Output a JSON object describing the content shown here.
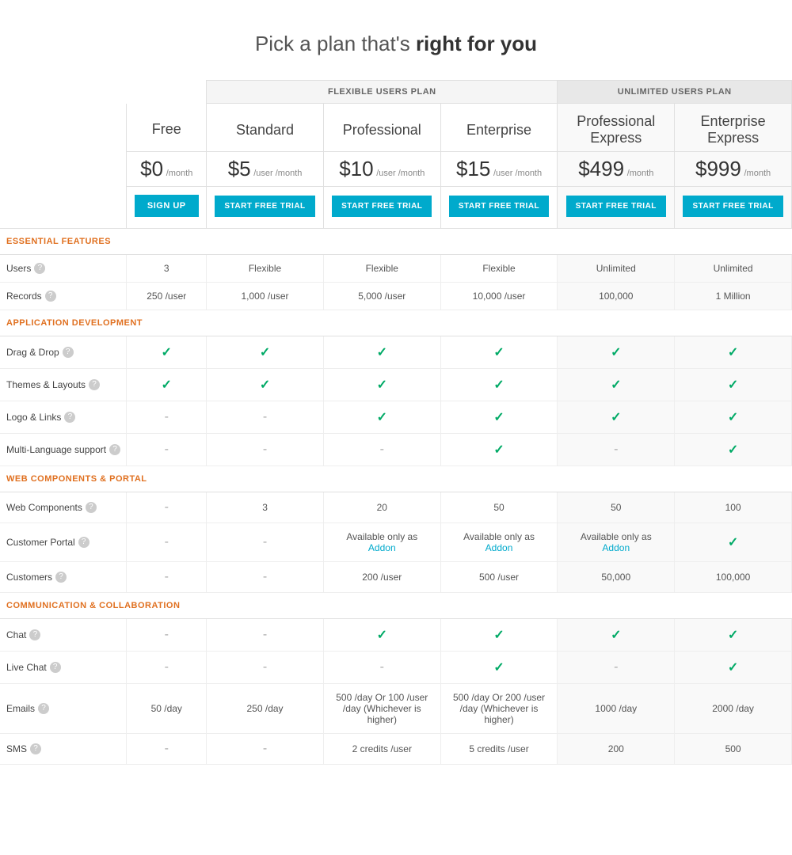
{
  "page": {
    "title_prefix": "Pick a plan that's ",
    "title_bold": "right for you"
  },
  "plans": {
    "flexible_label": "FLEXIBLE USERS PLAN",
    "unlimited_label": "UNLIMITED USERS PLAN",
    "columns": [
      {
        "id": "free",
        "name": "Free",
        "price": "$0",
        "price_sub": "/month",
        "cta": "SIGN UP",
        "cta_type": "signup"
      },
      {
        "id": "standard",
        "name": "Standard",
        "price": "$5",
        "price_sub": "/user /month",
        "cta": "START FREE TRIAL",
        "cta_type": "trial"
      },
      {
        "id": "professional",
        "name": "Professional",
        "price": "$10",
        "price_sub": "/user /month",
        "cta": "START FREE TRIAL",
        "cta_type": "trial"
      },
      {
        "id": "enterprise",
        "name": "Enterprise",
        "price": "$15",
        "price_sub": "/user /month",
        "cta": "START FREE TRIAL",
        "cta_type": "trial"
      },
      {
        "id": "pro_express",
        "name_line1": "Professional",
        "name_line2": "Express",
        "price": "$499",
        "price_sub": "/month",
        "cta": "START FREE TRIAL",
        "cta_type": "trial",
        "unlimited": true
      },
      {
        "id": "ent_express",
        "name_line1": "Enterprise",
        "name_line2": "Express",
        "price": "$999",
        "price_sub": "/month",
        "cta": "START FREE TRIAL",
        "cta_type": "trial",
        "unlimited": true
      }
    ]
  },
  "sections": [
    {
      "name": "ESSENTIAL FEATURES",
      "rows": [
        {
          "label": "Users",
          "help": true,
          "values": [
            "3",
            "Flexible",
            "Flexible",
            "Flexible",
            "Unlimited",
            "Unlimited"
          ]
        },
        {
          "label": "Records",
          "help": true,
          "values": [
            "250 /user",
            "1,000 /user",
            "5,000 /user",
            "10,000 /user",
            "100,000",
            "1 Million"
          ]
        }
      ]
    },
    {
      "name": "APPLICATION DEVELOPMENT",
      "rows": [
        {
          "label": "Drag & Drop",
          "help": true,
          "values": [
            "check",
            "check",
            "check",
            "check",
            "check",
            "check"
          ]
        },
        {
          "label": "Themes & Layouts",
          "help": true,
          "values": [
            "check",
            "check",
            "check",
            "check",
            "check",
            "check"
          ]
        },
        {
          "label": "Logo & Links",
          "help": true,
          "values": [
            "-",
            "-",
            "check",
            "check",
            "check",
            "check"
          ]
        },
        {
          "label": "Multi-Language support",
          "help": true,
          "values": [
            "-",
            "-",
            "-",
            "check",
            "-",
            "check"
          ]
        }
      ]
    },
    {
      "name": "WEB COMPONENTS & PORTAL",
      "rows": [
        {
          "label": "Web Components",
          "help": true,
          "values": [
            "-",
            "3",
            "20",
            "50",
            "50",
            "100"
          ]
        },
        {
          "label": "Customer Portal",
          "help": true,
          "values": [
            "-",
            "-",
            "addon",
            "addon",
            "addon",
            "check"
          ]
        },
        {
          "label": "Customers",
          "help": true,
          "values": [
            "-",
            "-",
            "200 /user",
            "500 /user",
            "50,000",
            "100,000"
          ]
        }
      ]
    },
    {
      "name": "COMMUNICATION & COLLABORATION",
      "rows": [
        {
          "label": "Chat",
          "help": true,
          "values": [
            "-",
            "-",
            "check",
            "check",
            "check",
            "check"
          ]
        },
        {
          "label": "Live Chat",
          "help": true,
          "values": [
            "-",
            "-",
            "-",
            "check",
            "-",
            "check"
          ]
        },
        {
          "label": "Emails",
          "help": true,
          "values": [
            "50 /day",
            "250 /day",
            "500 /day Or 100 /user /day (Whichever is higher)",
            "500 /day Or 200 /user /day (Whichever is higher)",
            "1000 /day",
            "2000 /day"
          ]
        },
        {
          "label": "SMS",
          "help": true,
          "values": [
            "-",
            "-",
            "2 credits /user",
            "5 credits /user",
            "200",
            "500"
          ]
        }
      ]
    }
  ],
  "addon_text": "Available only as",
  "addon_link_text": "Addon"
}
